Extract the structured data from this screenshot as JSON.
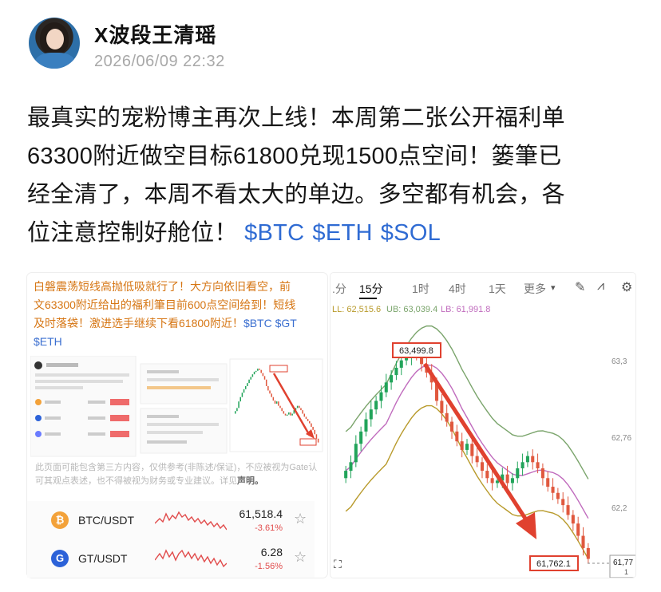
{
  "author": {
    "name": "X波段王清瑶",
    "timestamp": "2026/06/09 22:32"
  },
  "post": {
    "lines": [
      "最真实的宠粉博主再次上线！本周第二张公开福利单",
      "63300附近做空目标61800兑现1500点空间！篓筆已",
      "经全清了，本周不看太大的单边。多空都有机会，各",
      "位注意控制好舱位！"
    ],
    "tags": [
      "$BTC",
      "$ETH",
      "$SOL"
    ]
  },
  "left_card": {
    "text_lines": [
      "白磐震荡短线高抛低吸就行了！大方向依旧看空，前",
      "文63300附近给出的福利筆目前600点空间给到！短线",
      "及时落袋！激进选手继续下看61800附近！"
    ],
    "tags": [
      "$BTC",
      "$GT",
      "$ETH"
    ],
    "disclaimer": "此页面可能包含第三方内容，仅供参考(非陈述/保证)，不应被视为Gate认可其观点表述，也不得被视为财务或专业建议。详见",
    "disclaimer_link": "声明。",
    "tickers": [
      {
        "pair": "BTC/USDT",
        "price": "61,518.4",
        "change": "-3.61%",
        "icon": "btc-icon",
        "color": "#f3a23a"
      },
      {
        "pair": "GT/USDT",
        "price": "6.28",
        "change": "-1.56%",
        "icon": "gt-icon",
        "color": "#2c62d8"
      }
    ]
  },
  "chart_panel": {
    "timeframes": [
      ".分",
      "15分",
      "1时",
      "4时",
      "1天",
      "更多"
    ],
    "active_timeframe": "15分",
    "legend": {
      "ll": "LL: 62,515.6",
      "ub": "UB: 63,039.4",
      "lb": "LB: 61,991.8"
    },
    "price_labels": [
      "63,3",
      "62,76",
      "62,2"
    ],
    "high_label": "63,499.8",
    "low_label": "61,762.1",
    "last_price": "61,77",
    "last_price_sub": "1"
  },
  "chart_data": {
    "type": "candlestick",
    "high_annotation": 63499.8,
    "low_annotation": 61762.1,
    "closes": [
      62480,
      62550,
      62700,
      62800,
      62900,
      62980,
      63050,
      63120,
      63200,
      63260,
      63320,
      63380,
      63400,
      63450,
      63420,
      63350,
      63280,
      63200,
      63050,
      62950,
      62880,
      62800,
      62720,
      62650,
      62700,
      62600,
      62550,
      62480,
      62420,
      62380,
      62400,
      62450,
      62380,
      62420,
      62500,
      62550,
      62600,
      62550,
      62500,
      62420,
      62350,
      62300,
      62250,
      62200,
      62120,
      62050,
      61950,
      61850,
      61762
    ],
    "colors": {
      "up": "#21a45a",
      "down": "#e0583e",
      "upper_band": "#7aa46b",
      "middle_band": "#c06bbd",
      "lower_band": "#b89a2b",
      "arrow": "#e0412f"
    }
  }
}
